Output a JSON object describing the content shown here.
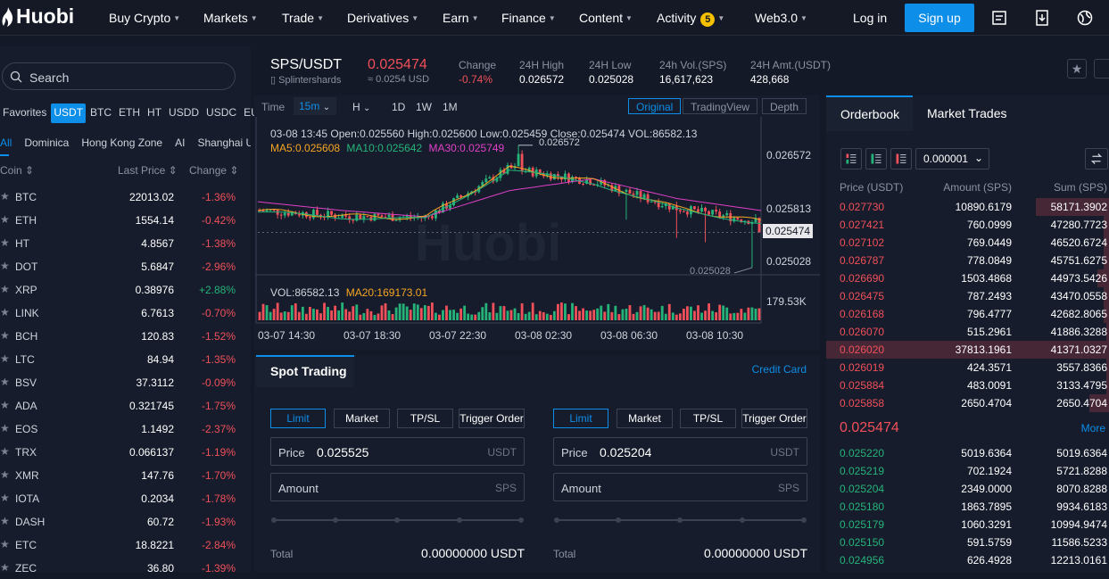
{
  "nav": {
    "logo": "Huobi",
    "items": [
      "Buy Crypto",
      "Markets",
      "Trade",
      "Derivatives",
      "Earn",
      "Finance",
      "Content",
      "Activity",
      "Web3.0"
    ],
    "activity_badge": "5",
    "login": "Log in",
    "signup": "Sign up"
  },
  "left": {
    "search_placeholder": "Search",
    "quote_tabs": [
      "Favorites",
      "USDT",
      "BTC",
      "ETH",
      "HT",
      "USDD",
      "USDC",
      "EUR"
    ],
    "active_quote": "USDT",
    "zone_tabs": [
      "All",
      "Dominica",
      "Hong Kong Zone",
      "AI",
      "Shanghai U"
    ],
    "col_coin": "Coin",
    "col_price": "Last Price",
    "col_change": "Change",
    "rows": [
      {
        "coin": "BTC",
        "price": "22013.02",
        "change": "-1.36%"
      },
      {
        "coin": "ETH",
        "price": "1554.14",
        "change": "-0.42%"
      },
      {
        "coin": "HT",
        "price": "4.8567",
        "change": "-1.38%"
      },
      {
        "coin": "DOT",
        "price": "5.6847",
        "change": "-2.96%"
      },
      {
        "coin": "XRP",
        "price": "0.38976",
        "change": "+2.88%"
      },
      {
        "coin": "LINK",
        "price": "6.7613",
        "change": "-0.70%"
      },
      {
        "coin": "BCH",
        "price": "120.83",
        "change": "-1.52%"
      },
      {
        "coin": "LTC",
        "price": "84.94",
        "change": "-1.35%"
      },
      {
        "coin": "BSV",
        "price": "37.3112",
        "change": "-0.09%"
      },
      {
        "coin": "ADA",
        "price": "0.321745",
        "change": "-1.75%"
      },
      {
        "coin": "EOS",
        "price": "1.1492",
        "change": "-2.37%"
      },
      {
        "coin": "TRX",
        "price": "0.066137",
        "change": "-1.19%"
      },
      {
        "coin": "XMR",
        "price": "147.76",
        "change": "-1.70%"
      },
      {
        "coin": "IOTA",
        "price": "0.2034",
        "change": "-1.78%"
      },
      {
        "coin": "DASH",
        "price": "60.72",
        "change": "-1.93%"
      },
      {
        "coin": "ETC",
        "price": "18.8221",
        "change": "-2.84%"
      },
      {
        "coin": "ZEC",
        "price": "36.80",
        "change": "-1.39%"
      }
    ]
  },
  "ticker": {
    "pair": "SPS/USDT",
    "name": "Splintershards",
    "last": "0.025474",
    "last_usd": "≈ 0.0254 USD",
    "stats": [
      {
        "label": "Change",
        "value": "-0.74%"
      },
      {
        "label": "24H High",
        "value": "0.026572"
      },
      {
        "label": "24H Low",
        "value": "0.025028"
      },
      {
        "label": "24h Vol.(SPS)",
        "value": "16,617,623"
      },
      {
        "label": "24H Amt.(USDT)",
        "value": "428,668"
      }
    ]
  },
  "chart": {
    "time_label": "Time",
    "interval": "15m",
    "intervals": [
      "H",
      "1D",
      "1W",
      "1M"
    ],
    "views": [
      "Original",
      "TradingView",
      "Depth"
    ],
    "ohlc": "03-08 13:45   Open:0.025560  High:0.025600  Low:0.025459  Close:0.025474  VOL:86582.13",
    "ma5": "MA5:0.025608",
    "ma10": "MA10:0.025642",
    "ma30": "MA30:0.025749",
    "vol_label": "VOL:86582.13",
    "vol_ma20": "MA20:169173.01",
    "high_marker": "0.026572",
    "low_marker": "0.025028",
    "y_ticks": [
      "0.026572",
      "0.025813",
      "0.025028"
    ],
    "current_price": "0.025474",
    "vol_tick": "179.53K",
    "x_ticks": [
      "03-07 14:30",
      "03-07 18:30",
      "03-07 22:30",
      "03-08 02:30",
      "03-08 06:30",
      "03-08 10:30"
    ],
    "watermark": "Huobi"
  },
  "chart_data": {
    "type": "line",
    "title": "SPS/USDT",
    "xlabel": "",
    "ylabel": "",
    "x": [
      "03-07 14:30",
      "03-07 18:30",
      "03-07 22:30",
      "03-08 02:30",
      "03-08 06:30",
      "03-08 10:30",
      "03-08 13:45"
    ],
    "series": [
      {
        "name": "MA5",
        "values": [
          0.02575,
          0.02568,
          0.02566,
          0.02628,
          0.02612,
          0.02578,
          0.025608
        ]
      },
      {
        "name": "MA30",
        "values": [
          0.02586,
          0.02575,
          0.02567,
          0.026,
          0.02615,
          0.0259,
          0.025749
        ]
      }
    ],
    "ylim": [
      0.02495,
      0.02675
    ],
    "high": 0.026572,
    "low": 0.025028,
    "close": 0.025474
  },
  "spot": {
    "title": "Spot Trading",
    "credit": "Credit Card",
    "order_types": [
      "Limit",
      "Market",
      "TP/SL",
      "Trigger Order"
    ],
    "buy": {
      "price_label": "Price",
      "price": "0.025525",
      "price_unit": "USDT",
      "amount_label": "Amount",
      "amount_unit": "SPS",
      "total_label": "Total",
      "total": "0.00000000 USDT"
    },
    "sell": {
      "price_label": "Price",
      "price": "0.025204",
      "price_unit": "USDT",
      "amount_label": "Amount",
      "amount_unit": "SPS",
      "total_label": "Total",
      "total": "0.00000000 USDT"
    }
  },
  "orderbook": {
    "tab": "Orderbook",
    "tab2": "Market Trades",
    "precision": "0.000001",
    "col_price": "Price (USDT)",
    "col_amount": "Amount (SPS)",
    "col_sum": "Sum (SPS)",
    "asks": [
      {
        "price": "0.027730",
        "amount": "10890.6179",
        "sum": "58171.3902",
        "fill": 0.26
      },
      {
        "price": "0.027421",
        "amount": "760.0999",
        "sum": "47280.7723",
        "fill": 0.02
      },
      {
        "price": "0.027102",
        "amount": "769.0449",
        "sum": "46520.6724",
        "fill": 0.02
      },
      {
        "price": "0.026787",
        "amount": "778.0849",
        "sum": "45751.6275",
        "fill": 0.02
      },
      {
        "price": "0.026690",
        "amount": "1503.4868",
        "sum": "44973.5426",
        "fill": 0.04
      },
      {
        "price": "0.026475",
        "amount": "787.2493",
        "sum": "43470.0558",
        "fill": 0.02
      },
      {
        "price": "0.026168",
        "amount": "796.4777",
        "sum": "42682.8065",
        "fill": 0.02
      },
      {
        "price": "0.026070",
        "amount": "515.2961",
        "sum": "41886.3288",
        "fill": 0.01
      },
      {
        "price": "0.026020",
        "amount": "37813.1961",
        "sum": "41371.0327",
        "fill": 1.0
      },
      {
        "price": "0.026019",
        "amount": "424.3571",
        "sum": "3557.8366",
        "fill": 0.01
      },
      {
        "price": "0.025884",
        "amount": "483.0091",
        "sum": "3133.4795",
        "fill": 0.01
      },
      {
        "price": "0.025858",
        "amount": "2650.4704",
        "sum": "2650.4704",
        "fill": 0.07
      }
    ],
    "mid": "0.025474",
    "more": "More",
    "bids": [
      {
        "price": "0.025220",
        "amount": "5019.6364",
        "sum": "5019.6364"
      },
      {
        "price": "0.025219",
        "amount": "702.1924",
        "sum": "5721.8288"
      },
      {
        "price": "0.025204",
        "amount": "2349.0000",
        "sum": "8070.8288"
      },
      {
        "price": "0.025180",
        "amount": "1863.7895",
        "sum": "9934.6183"
      },
      {
        "price": "0.025179",
        "amount": "1060.3291",
        "sum": "10994.9474"
      },
      {
        "price": "0.025150",
        "amount": "591.5759",
        "sum": "11586.5233"
      },
      {
        "price": "0.024956",
        "amount": "626.4928",
        "sum": "12213.0161"
      }
    ]
  },
  "colors": {
    "accent": "#0d8ee8",
    "up": "#26b37a",
    "down": "#f0505a",
    "ma5": "#f5a623",
    "ma10": "#26b37a",
    "ma30": "#e040c8"
  }
}
